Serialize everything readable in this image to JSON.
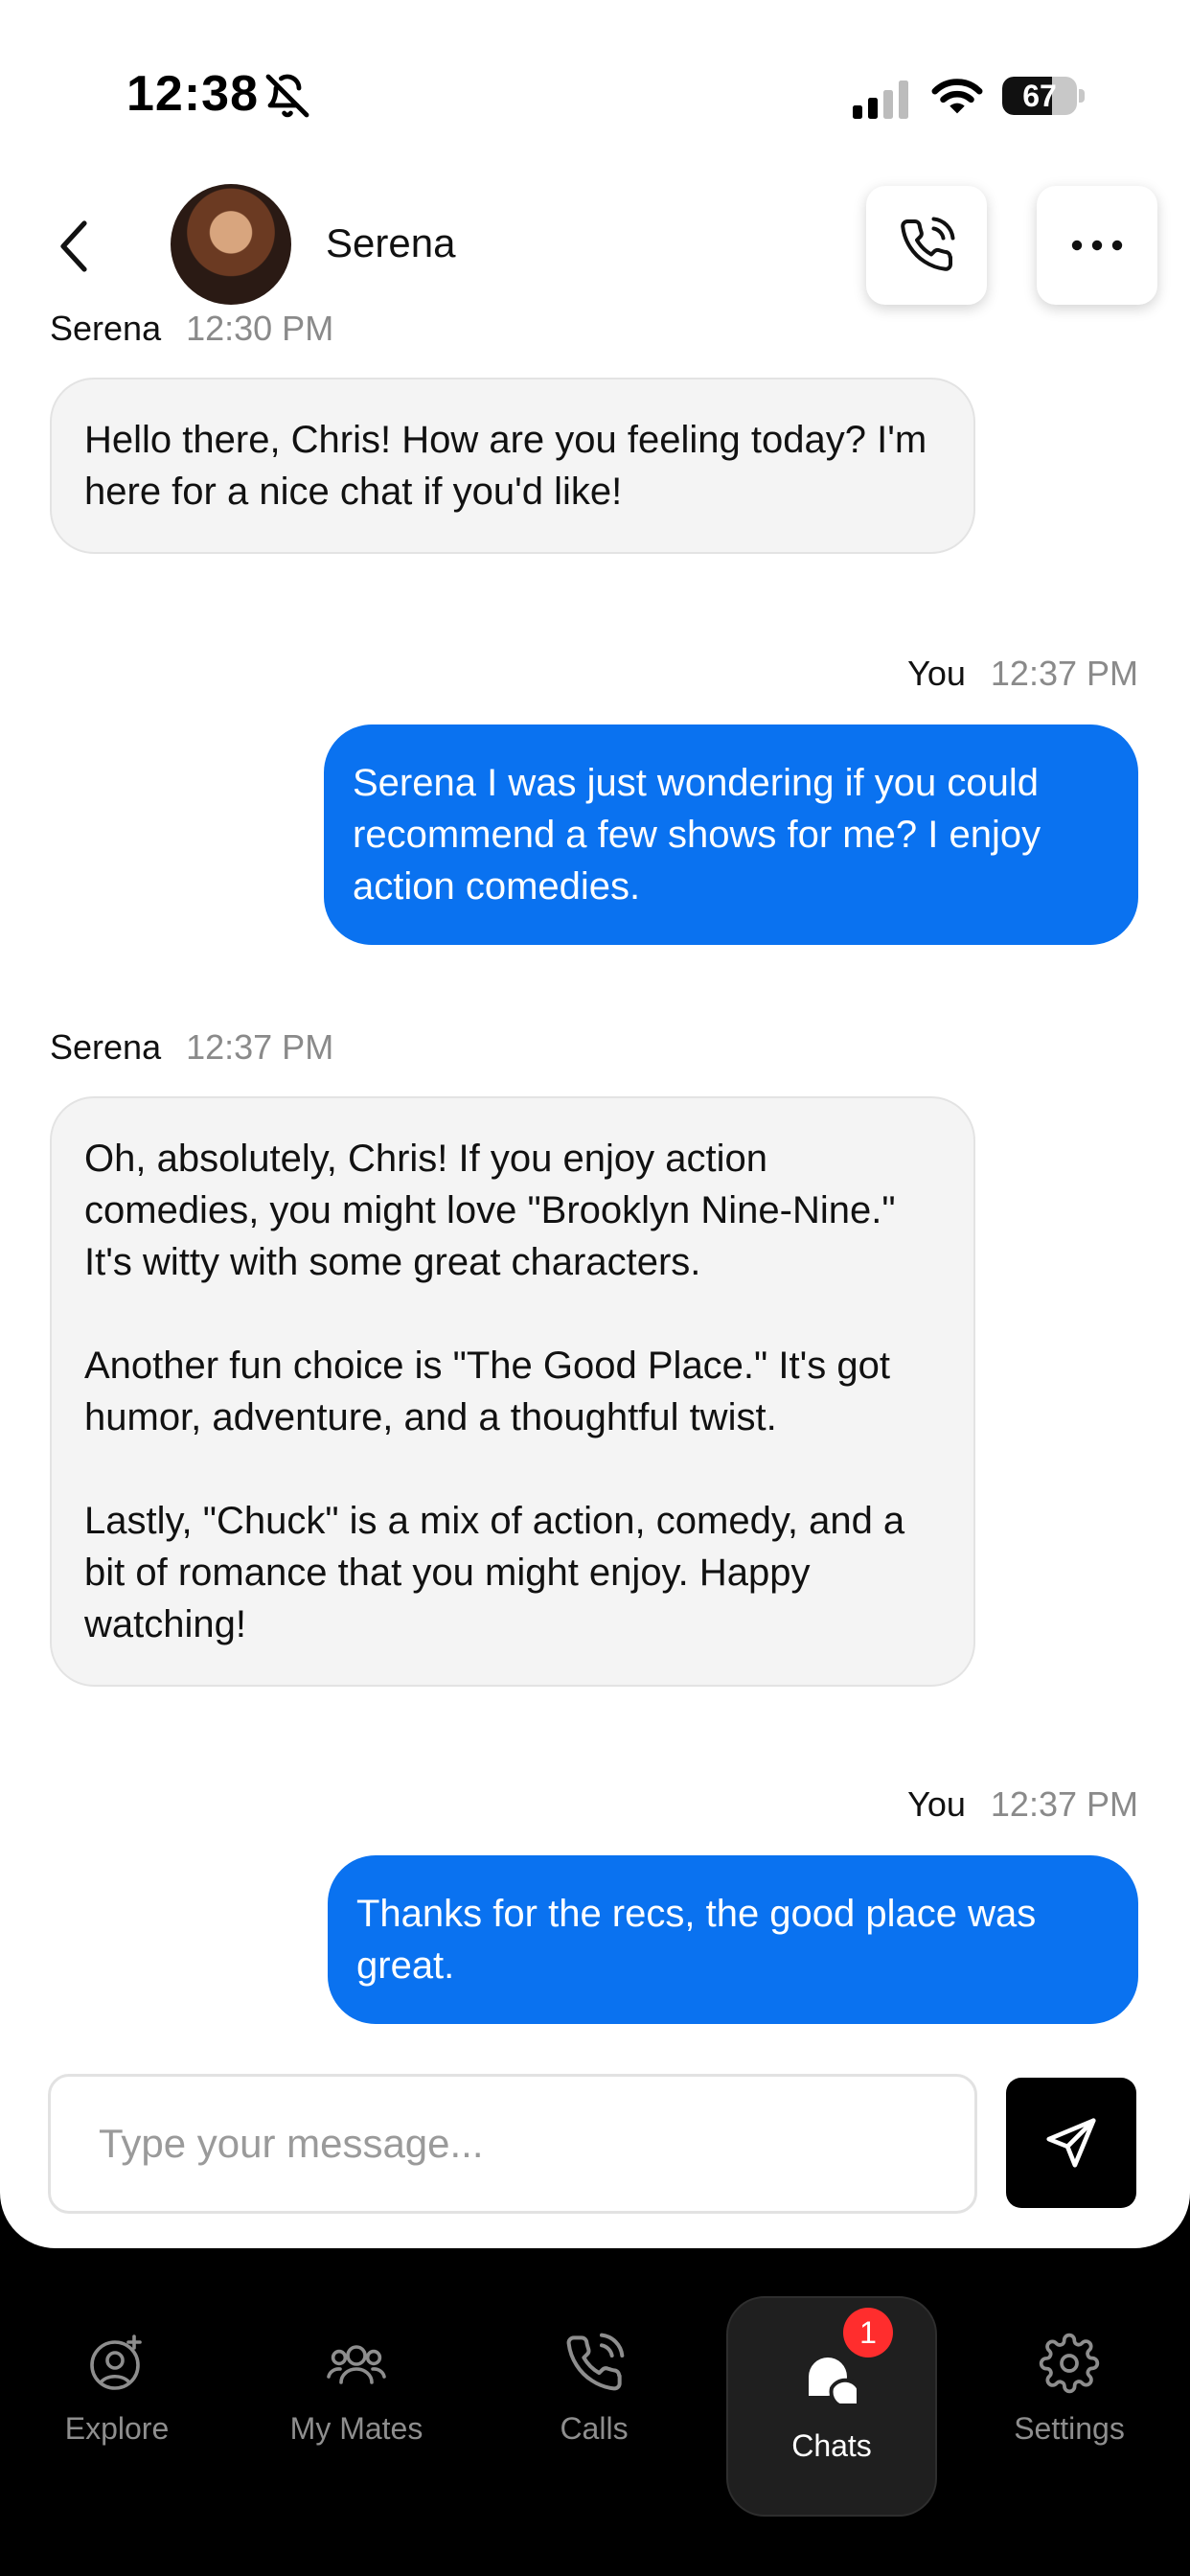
{
  "status_bar": {
    "time": "12:38",
    "battery": "67",
    "battery_level": 0.67
  },
  "header": {
    "contact_name": "Serena"
  },
  "messages": [
    {
      "sender": "Serena",
      "time": "12:30 PM",
      "text": "Hello there, Chris! How are you feeling today? I'm here for a nice chat if you'd like!"
    },
    {
      "sender": "You",
      "time": "12:37 PM",
      "text": "Serena I was just wondering if you could recommend a few shows for me? I enjoy action comedies."
    },
    {
      "sender": "Serena",
      "time": "12:37 PM",
      "text": "Oh, absolutely, Chris! If you enjoy action comedies, you might love \"Brooklyn Nine-Nine.\" It's witty with some great characters.\n\nAnother fun choice is \"The Good Place.\" It's got humor, adventure, and a thoughtful twist.\n\nLastly, \"Chuck\" is a mix of action, comedy, and a bit of romance that you might enjoy. Happy watching!"
    },
    {
      "sender": "You",
      "time": "12:37 PM",
      "text": "Thanks for the recs, the good place was great."
    }
  ],
  "composer": {
    "placeholder": "Type your message..."
  },
  "nav": {
    "items": [
      {
        "label": "Explore",
        "icon": "explore-icon"
      },
      {
        "label": "My Mates",
        "icon": "mates-icon"
      },
      {
        "label": "Calls",
        "icon": "calls-icon"
      },
      {
        "label": "Chats",
        "icon": "chats-icon",
        "badge": "1",
        "active": true
      },
      {
        "label": "Settings",
        "icon": "gear-icon"
      }
    ]
  },
  "colors": {
    "outgoing_bubble": "#0a72f0",
    "incoming_bubble": "#f4f4f4",
    "badge": "#ff2d2d",
    "nav_bg": "#000000"
  }
}
